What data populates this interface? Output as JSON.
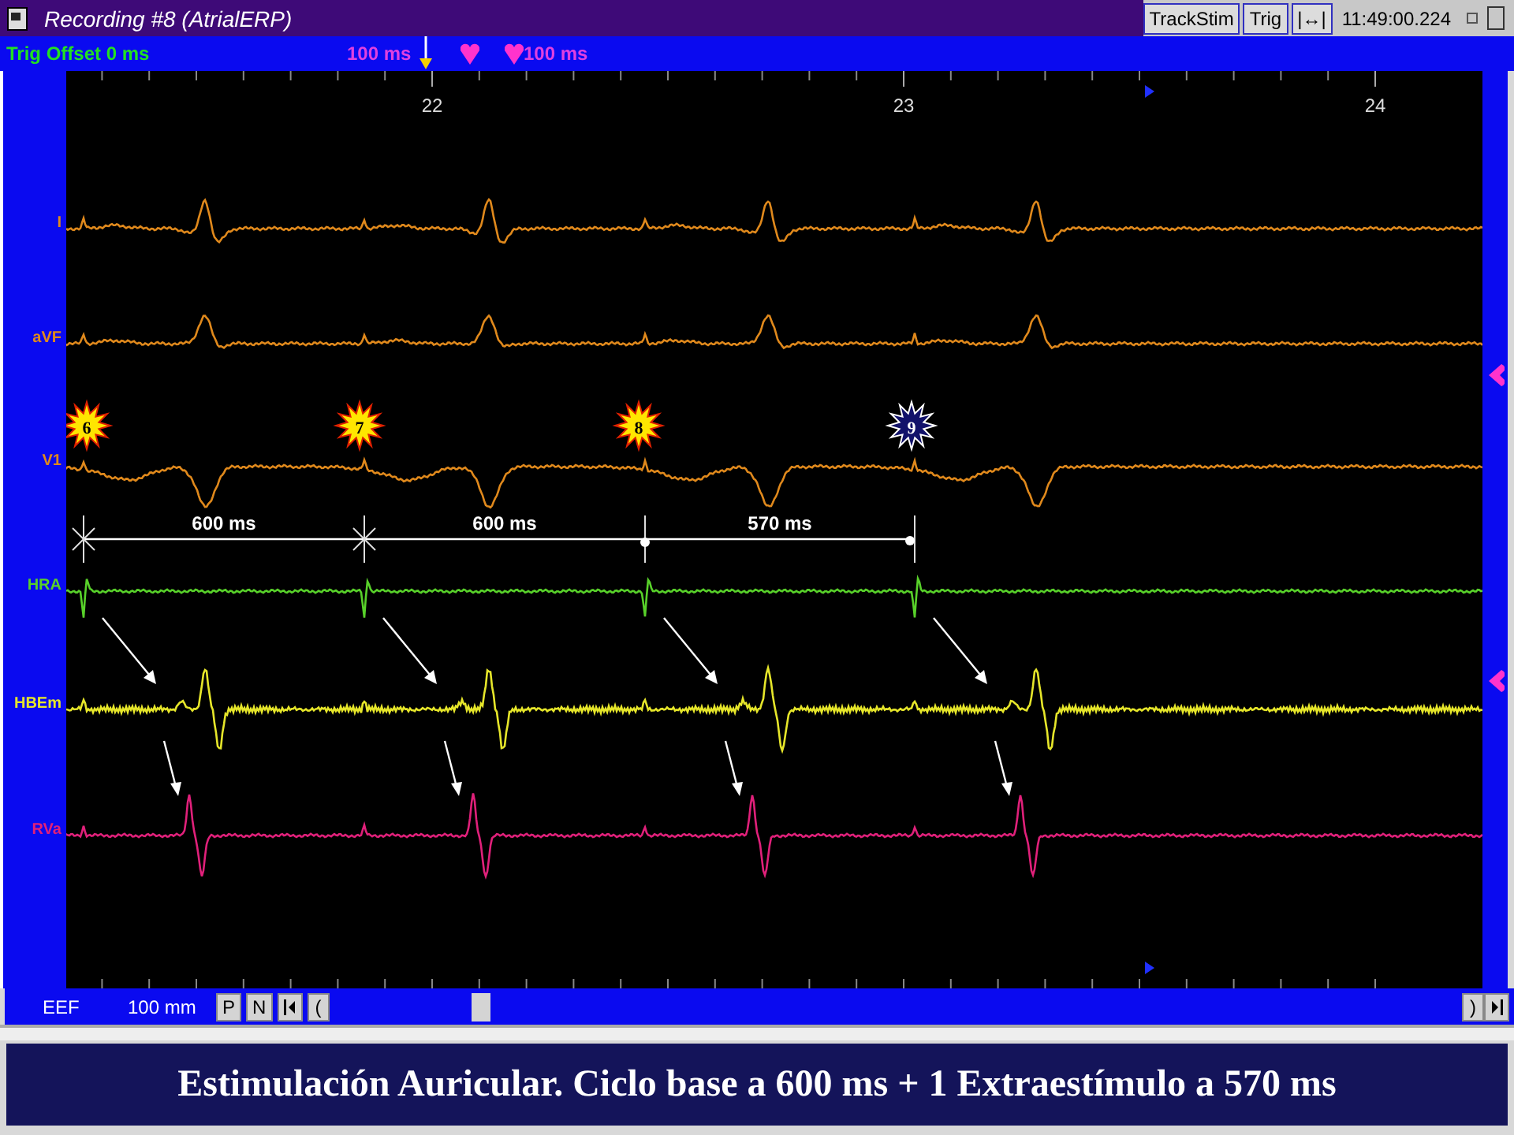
{
  "window": {
    "title": "Recording #8 (AtrialERP)",
    "buttons": [
      "TrackStim",
      "Trig",
      "|↔|"
    ],
    "clock": "11:49:00.224"
  },
  "toolbar": {
    "trig_offset": "Trig Offset 0 ms",
    "left_window": "100 ms",
    "right_window": "100 ms"
  },
  "time_labels": [
    "22",
    "23",
    "24"
  ],
  "channels": [
    {
      "name": "I",
      "color": "#e0891c"
    },
    {
      "name": "aVF",
      "color": "#e0891c"
    },
    {
      "name": "V1",
      "color": "#e0891c"
    },
    {
      "name": "HRA",
      "color": "#58d12a"
    },
    {
      "name": "HBEm",
      "color": "#e6e62a"
    },
    {
      "name": "RVa",
      "color": "#e0207a"
    }
  ],
  "stimuli": [
    {
      "number": "6",
      "kind": "s1"
    },
    {
      "number": "7",
      "kind": "s1"
    },
    {
      "number": "8",
      "kind": "s1"
    },
    {
      "number": "9",
      "kind": "s2"
    }
  ],
  "intervals": [
    "600 ms",
    "600 ms",
    "570 ms"
  ],
  "bottom_bar": {
    "protocol": "EEF",
    "speed": "100 mm",
    "buttons": [
      "P",
      "N"
    ],
    "scroll_left": "(",
    "scroll_right": ")"
  },
  "caption": "Estimulación Auricular. Ciclo base a 600 ms + 1 Extraestímulo a 570 ms"
}
